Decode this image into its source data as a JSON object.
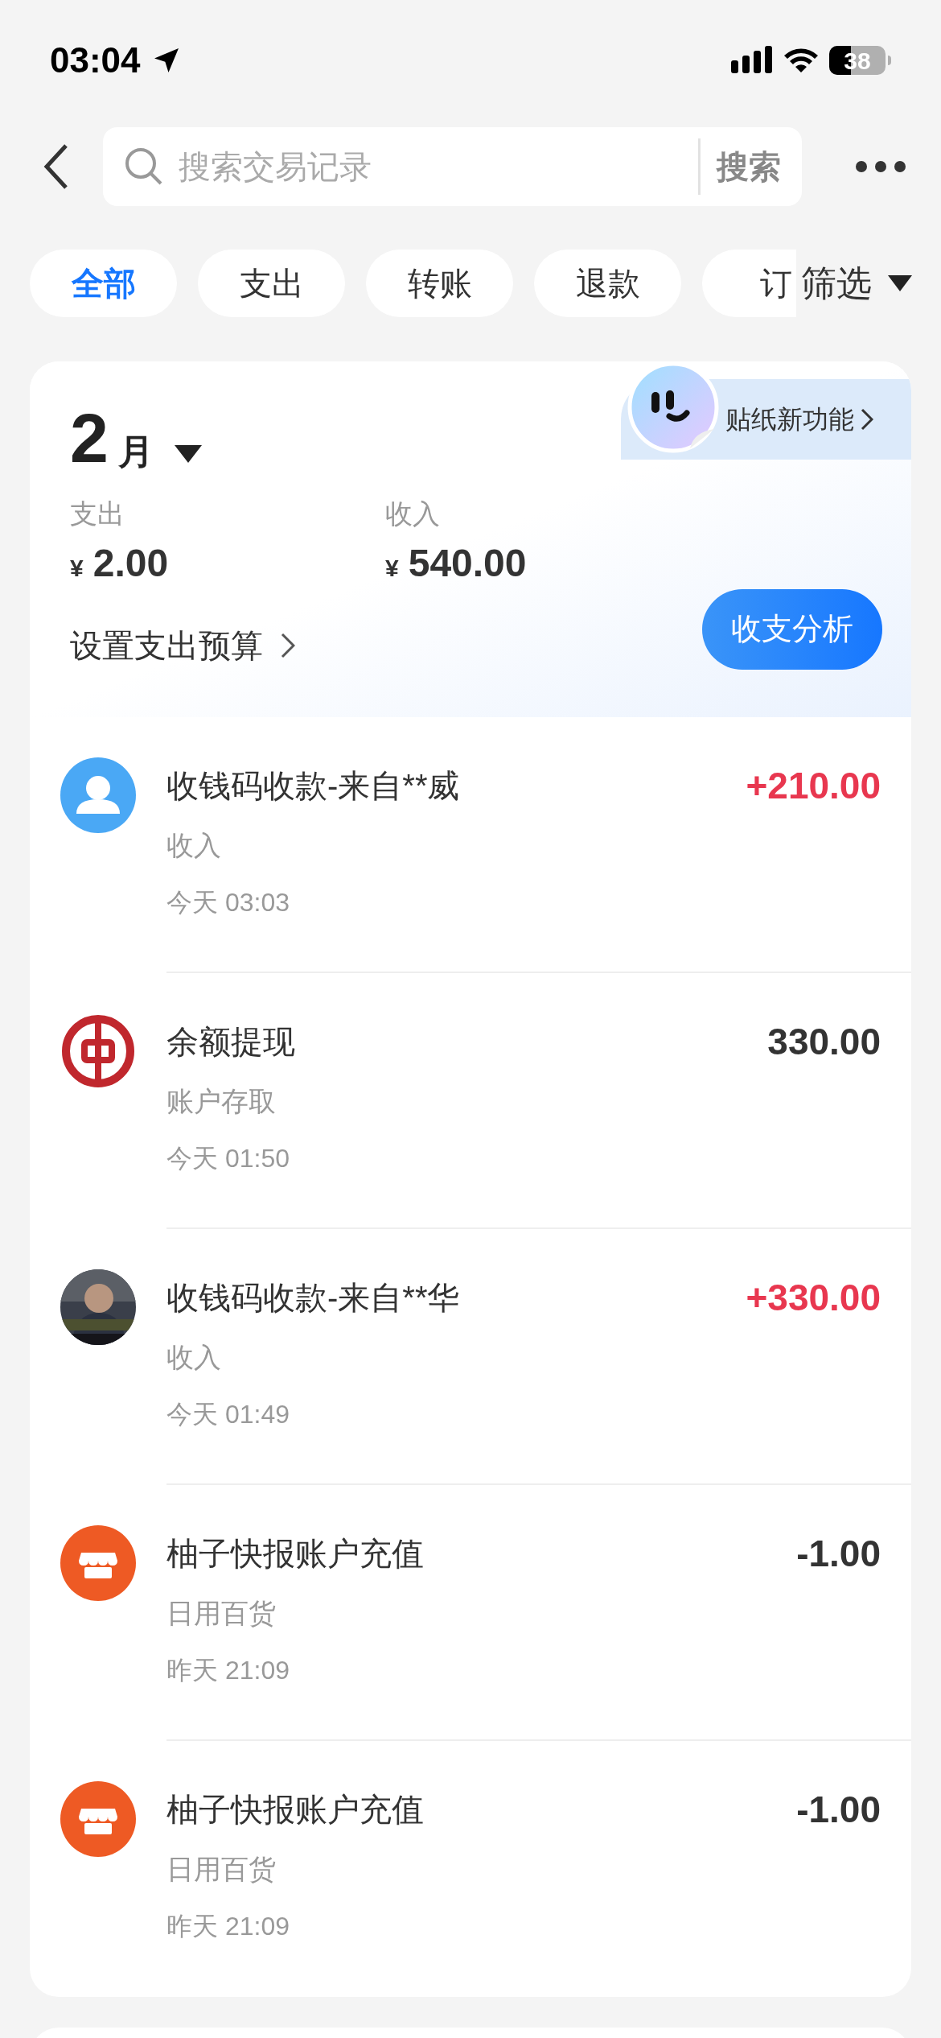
{
  "status_bar": {
    "time": "03:04",
    "battery": "38"
  },
  "search": {
    "placeholder": "搜索交易记录",
    "button": "搜索"
  },
  "tabs": [
    {
      "label": "全部",
      "selected": true
    },
    {
      "label": "支出",
      "selected": false
    },
    {
      "label": "转账",
      "selected": false
    },
    {
      "label": "退款",
      "selected": false
    },
    {
      "label": "订",
      "selected": false
    }
  ],
  "filter": "筛选",
  "summary": {
    "month": "2",
    "month_unit": "月",
    "sticker_promo": "贴纸新功能",
    "stats": [
      {
        "label": "支出",
        "currency": "¥",
        "amount": "2.00"
      },
      {
        "label": "收入",
        "currency": "¥",
        "amount": "540.00"
      }
    ],
    "budget_link": "设置支出预算",
    "analysis_button": "收支分析"
  },
  "transactions": [
    {
      "kind": "person",
      "title": "收钱码收款-来自**威",
      "category": "收入",
      "time": "今天 03:03",
      "amount": "+210.00",
      "income": true
    },
    {
      "kind": "bank",
      "title": "余额提现",
      "category": "账户存取",
      "time": "今天 01:50",
      "amount": "330.00",
      "income": false
    },
    {
      "title": "收钱码收款-来自**华",
      "category": "收入",
      "time": "今天 01:49",
      "amount": "+330.00",
      "income": true
    },
    {
      "kind": "shop",
      "title": "柚子快报账户充值",
      "category": "日用百货",
      "time": "昨天 21:09",
      "amount": "-1.00",
      "income": false
    },
    {
      "kind": "shop",
      "title": "柚子快报账户充值",
      "category": "日用百货",
      "time": "昨天 21:09",
      "amount": "-1.00",
      "income": false
    }
  ]
}
